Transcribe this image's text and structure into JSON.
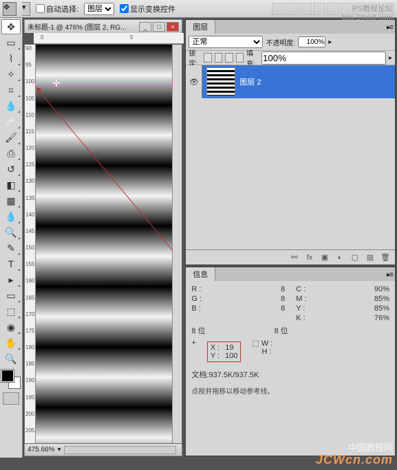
{
  "topbar": {
    "auto_select_label": "自动选择:",
    "auto_select_value": "图层",
    "show_transform_label": "显示变换控件"
  },
  "document": {
    "title": "未标题-1 @ 476% (图层 2, RG...",
    "zoom": "475.66%",
    "h_ruler_marks": [
      "0",
      "5",
      "0"
    ],
    "v_ruler_marks": [
      "90",
      "95",
      "100",
      "105",
      "110",
      "115",
      "120",
      "125",
      "130",
      "135",
      "140",
      "145",
      "150",
      "155",
      "160",
      "165",
      "170",
      "175",
      "180",
      "185",
      "190",
      "195",
      "200",
      "205"
    ]
  },
  "layers_panel": {
    "title": "图层",
    "blend_mode": "正常",
    "opacity_label": "不透明度:",
    "opacity_value": "100%",
    "lock_label": "锁定:",
    "fill_label": "填充:",
    "fill_value": "100%",
    "layer_name": "图层 2"
  },
  "info_panel": {
    "title": "信息",
    "R_label": "R :",
    "R_val": "8",
    "G_label": "G :",
    "G_val": "8",
    "B_label": "B :",
    "B_val": "8",
    "C_label": "C :",
    "C_val": "90%",
    "M_label": "M :",
    "M_val": "85%",
    "Y_label": "Y :",
    "Y_val": "85%",
    "K_label": "K :",
    "K_val": "76%",
    "bit_depth": "8 位",
    "bit_depth2": "8 位",
    "X_label": "X :",
    "X_val": "19",
    "Ypos_label": "Y :",
    "Ypos_val": "100",
    "W_label": "W :",
    "W_val": "",
    "H_label": "H :",
    "H_val": "",
    "doc_size": "文档:937.5K/937.5K",
    "hint": "点按并拖移以移动参考线。"
  },
  "watermarks": {
    "top": "PS教程论坛",
    "top2": "bbs.16xx8.com",
    "mid": "中国教程网",
    "bottom": "JCWcn.com"
  }
}
